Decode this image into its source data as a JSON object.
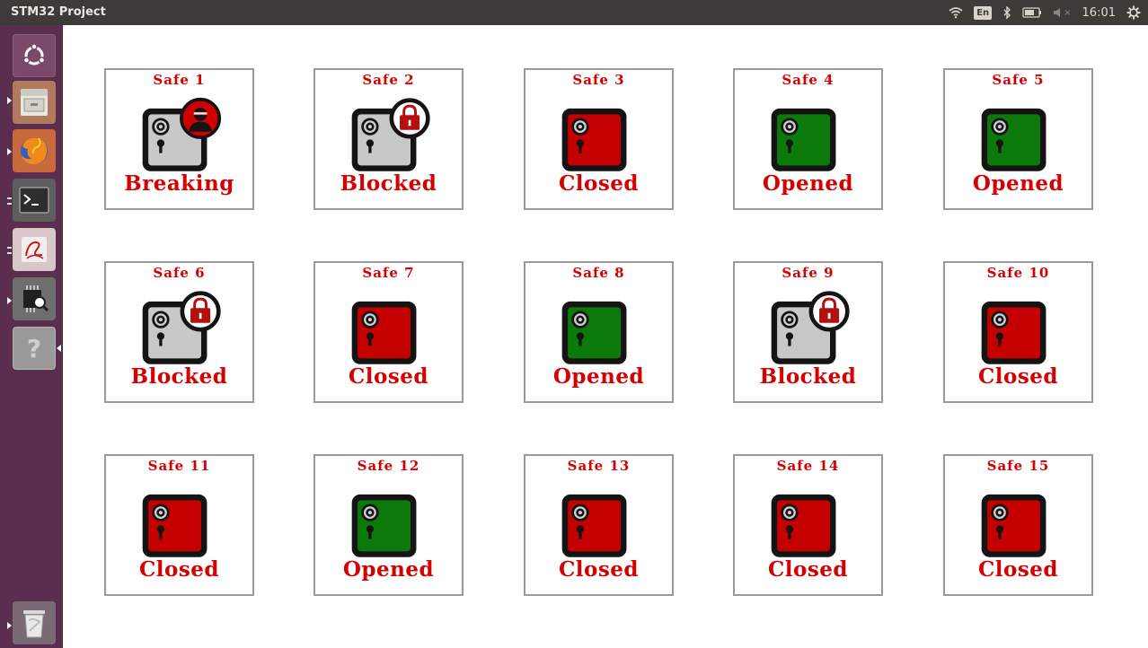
{
  "window": {
    "title": "STM32 Project"
  },
  "panel": {
    "keyboard_layout": "En",
    "volume_symbol": "×",
    "clock": "16:01",
    "icons": [
      "wifi-icon",
      "keyboard-layout-indicator",
      "bluetooth-icon",
      "battery-icon",
      "volume-muted-icon",
      "settings-gear-icon"
    ]
  },
  "launcher": {
    "items": [
      {
        "name": "ubuntu-dash-icon"
      },
      {
        "name": "files-icon"
      },
      {
        "name": "firefox-icon"
      },
      {
        "name": "terminal-icon"
      },
      {
        "name": "text-editor-icon"
      },
      {
        "name": "stm32-tool-icon"
      },
      {
        "name": "help-icon",
        "glyph": "?"
      },
      {
        "name": "trash-icon"
      }
    ]
  },
  "colors": {
    "accent_red": "#d50000",
    "closed_red": "#c50000",
    "opened_green": "#0b7a0b",
    "blocked_grey": "#c8c8c8"
  },
  "safes": [
    {
      "name": "Safe 1",
      "status": "Breaking"
    },
    {
      "name": "Safe 2",
      "status": "Blocked"
    },
    {
      "name": "Safe 3",
      "status": "Closed"
    },
    {
      "name": "Safe 4",
      "status": "Opened"
    },
    {
      "name": "Safe 5",
      "status": "Opened"
    },
    {
      "name": "Safe 6",
      "status": "Blocked"
    },
    {
      "name": "Safe 7",
      "status": "Closed"
    },
    {
      "name": "Safe 8",
      "status": "Opened"
    },
    {
      "name": "Safe 9",
      "status": "Blocked"
    },
    {
      "name": "Safe 10",
      "status": "Closed"
    },
    {
      "name": "Safe 11",
      "status": "Closed"
    },
    {
      "name": "Safe 12",
      "status": "Opened"
    },
    {
      "name": "Safe 13",
      "status": "Closed"
    },
    {
      "name": "Safe 14",
      "status": "Closed"
    },
    {
      "name": "Safe 15",
      "status": "Closed"
    }
  ]
}
